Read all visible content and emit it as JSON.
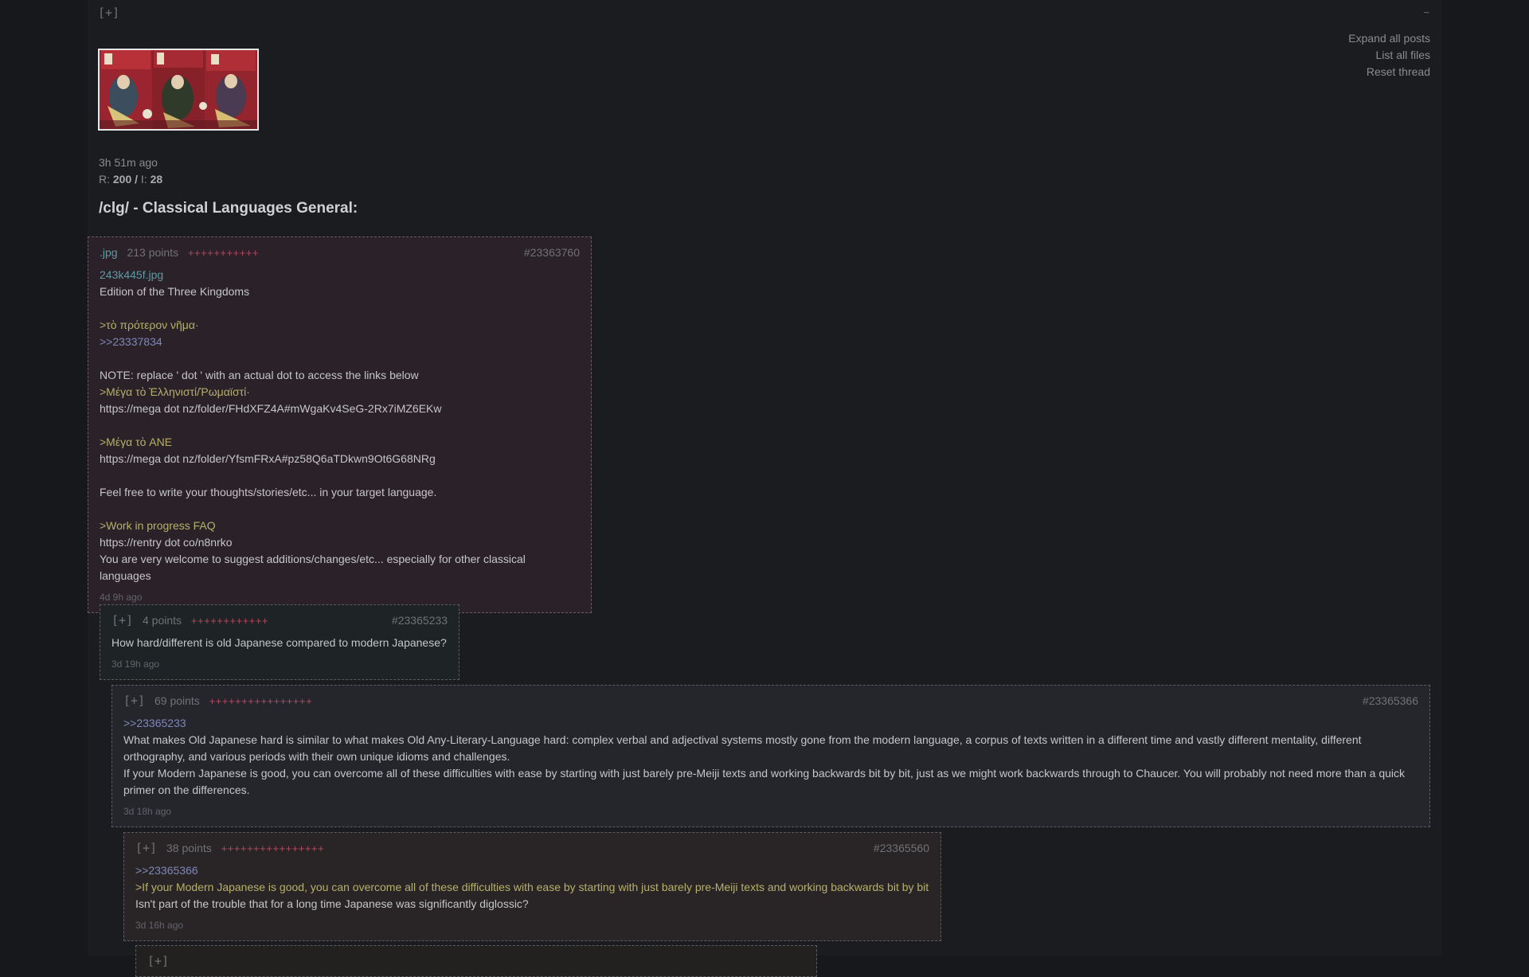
{
  "thread": {
    "toggle": "[+]",
    "tilde": "~",
    "menu": [
      "Expand all posts",
      "List all files",
      "Reset thread"
    ],
    "op_age": "3h 51m ago",
    "stats": {
      "r_label": "R: ",
      "replies": "200",
      "sep": " / ",
      "i_label": "I: ",
      "images": "28"
    },
    "title": "/clg/ - Classical Languages General:"
  },
  "op": {
    "ext": ".jpg",
    "points": "213 points",
    "bar": "+++++++++++",
    "postno": "#23363760",
    "filename": "243k445f.jpg",
    "lines": [
      {
        "t": "Edition of the Three Kingdoms",
        "c": ""
      },
      {
        "t": "",
        "c": ""
      },
      {
        "t": ">τὸ πρότερον νῆμα·",
        "c": "greentext"
      },
      {
        "t": ">>23337834",
        "c": "quotelink"
      },
      {
        "t": "",
        "c": ""
      },
      {
        "t": "NOTE: replace ' dot ' with an actual dot to access the links below",
        "c": ""
      },
      {
        "t": ">Μέγα τὸ Ἑλληνιστί/Ῥωμαϊστί·",
        "c": "greentext"
      },
      {
        "t": "https://mega dot nz/folder/FHdXFZ4A#mWgaKv4SeG-2Rx7iMZ6EKw",
        "c": ""
      },
      {
        "t": "",
        "c": ""
      },
      {
        "t": ">Μέγα τὸ ANE",
        "c": "greentext"
      },
      {
        "t": "https://mega dot nz/folder/YfsmFRxA#pz58Q6aTDkwn9Ot6G68NRg",
        "c": ""
      },
      {
        "t": "",
        "c": ""
      },
      {
        "t": "Feel free to write your thoughts/stories/etc... in your target language.",
        "c": ""
      },
      {
        "t": "",
        "c": ""
      },
      {
        "t": ">Work in progress FAQ",
        "c": "greentext"
      },
      {
        "t": "https://rentry dot co/n8nrko",
        "c": ""
      },
      {
        "t": "You are very welcome to suggest additions/changes/etc... especially for other classical languages",
        "c": ""
      }
    ],
    "time": "4d 9h ago"
  },
  "replies": [
    {
      "toggle": "[+]",
      "points": "4 points",
      "bar": "++++++++++++",
      "postno": "#23365233",
      "lines": [
        {
          "t": "How hard/different is old Japanese compared to modern Japanese?",
          "c": ""
        }
      ],
      "time": "3d 19h ago"
    },
    {
      "toggle": "[+]",
      "points": "69 points",
      "bar": "++++++++++++++++",
      "postno": "#23365366",
      "lines": [
        {
          "t": ">>23365233",
          "c": "quotelink"
        },
        {
          "t": "What makes Old Japanese hard is similar to what makes Old Any-Literary-Language hard: complex verbal and adjectival systems mostly gone from the modern language, a corpus of texts written in a different time and vastly different mentality, different orthography, and various periods with their own unique idioms and challenges.",
          "c": ""
        },
        {
          "t": "If your Modern Japanese is good, you can overcome all of these difficulties with ease by starting with just barely pre-Meiji texts and working backwards bit by bit, just as we might work backwards through to Chaucer. You will probably not need more than a quick primer on the differences.",
          "c": ""
        }
      ],
      "time": "3d 18h ago"
    },
    {
      "toggle": "[+]",
      "points": "38 points",
      "bar": "++++++++++++++++",
      "postno": "#23365560",
      "lines": [
        {
          "t": ">>23365366",
          "c": "quotelink"
        },
        {
          "t": ">If your Modern Japanese is good, you can overcome all of these difficulties with ease by starting with just barely pre-Meiji texts and working backwards bit by bit",
          "c": "greentext"
        },
        {
          "t": "Isn't part of the trouble that for a long time Japanese was significantly diglossic?",
          "c": ""
        }
      ],
      "time": "3d 16h ago"
    },
    {
      "toggle": "[+]"
    }
  ]
}
